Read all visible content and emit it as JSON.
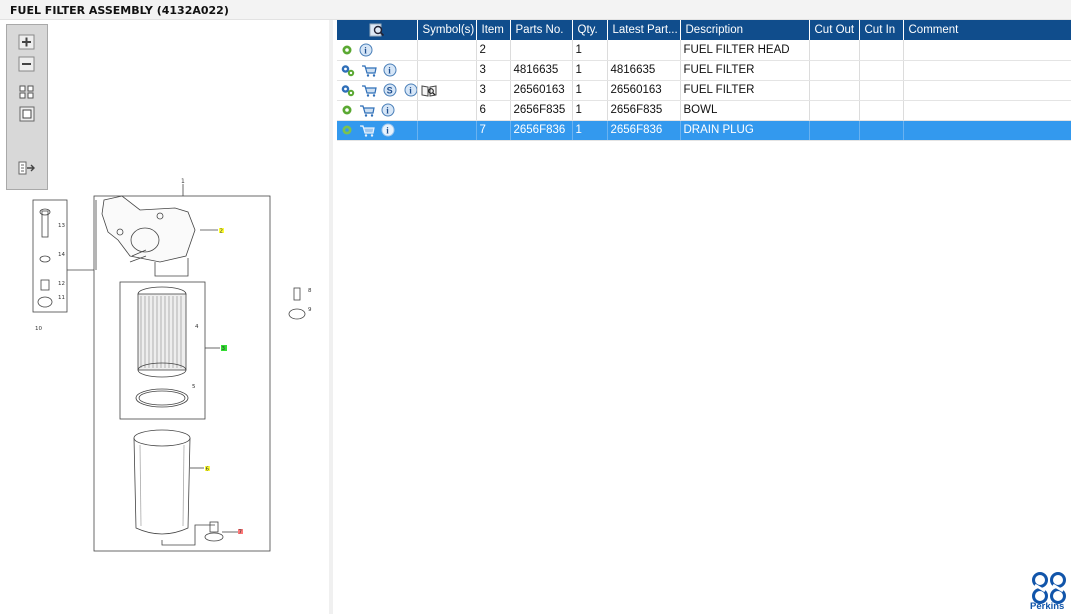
{
  "window": {
    "title": "FUEL FILTER ASSEMBLY (4132A022)"
  },
  "toolbox": {
    "buttons": [
      "zoom-in",
      "zoom-out",
      "fit-all",
      "fit-window",
      "export"
    ]
  },
  "diagram": {
    "callouts": [
      "1",
      "2",
      "3",
      "4",
      "5",
      "6",
      "7",
      "8",
      "9",
      "10",
      "11",
      "12",
      "13",
      "14"
    ]
  },
  "table": {
    "columns": [
      "",
      "Symbol(s)",
      "Item",
      "Parts No.",
      "Qty.",
      "Latest Part...",
      "Description",
      "Cut Out",
      "Cut In",
      "Comment"
    ],
    "rows": [
      {
        "icons": [
          "gear",
          "info"
        ],
        "symbol": "",
        "item": "2",
        "part_no": "",
        "qty": "1",
        "latest": "",
        "description": "FUEL FILTER HEAD",
        "cut_out": "",
        "cut_in": "",
        "comment": ""
      },
      {
        "icons": [
          "gears",
          "cart",
          "info"
        ],
        "symbol": "",
        "item": "3",
        "part_no": "4816635",
        "qty": "1",
        "latest": "4816635",
        "description": "FUEL FILTER",
        "cut_out": "",
        "cut_in": "",
        "comment": ""
      },
      {
        "icons": [
          "gears",
          "cart",
          "s",
          "info"
        ],
        "symbol": "book",
        "item": "3",
        "part_no": "26560163",
        "qty": "1",
        "latest": "26560163",
        "description": "FUEL FILTER",
        "cut_out": "",
        "cut_in": "",
        "comment": ""
      },
      {
        "icons": [
          "gear",
          "cart",
          "info"
        ],
        "symbol": "",
        "item": "6",
        "part_no": "2656F835",
        "qty": "1",
        "latest": "2656F835",
        "description": "BOWL",
        "cut_out": "",
        "cut_in": "",
        "comment": ""
      },
      {
        "icons": [
          "gear",
          "cart",
          "info"
        ],
        "symbol": "",
        "item": "7",
        "part_no": "2656F836",
        "qty": "1",
        "latest": "2656F836",
        "description": "DRAIN PLUG",
        "cut_out": "",
        "cut_in": "",
        "comment": "",
        "selected": true
      }
    ]
  },
  "brand": {
    "name": "Perkins",
    "color": "#1155aa"
  },
  "colors": {
    "header": "#104d8c",
    "selection": "#3399ee",
    "toolbox": "#d8d8d8"
  }
}
